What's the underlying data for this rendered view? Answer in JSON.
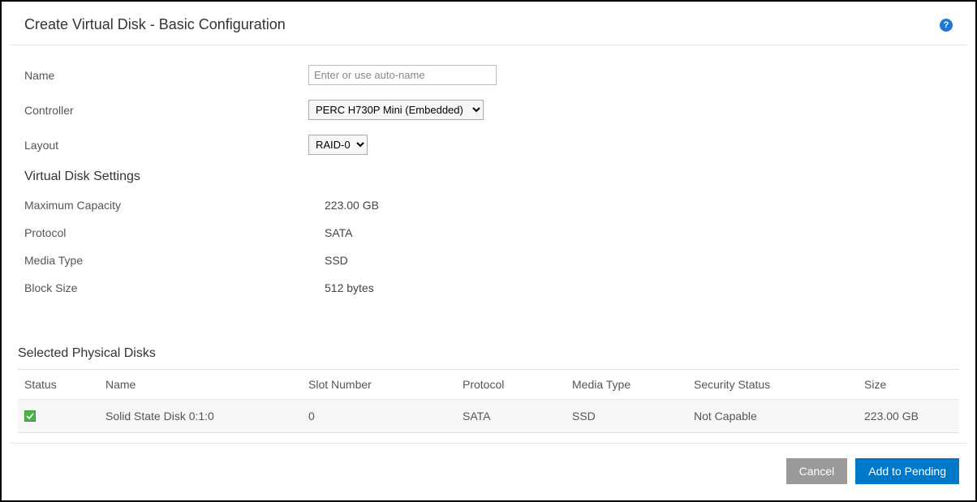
{
  "header": {
    "title": "Create Virtual Disk - Basic Configuration"
  },
  "form": {
    "name_label": "Name",
    "name_placeholder": "Enter or use auto-name",
    "controller_label": "Controller",
    "controller_value": "PERC H730P Mini (Embedded)",
    "layout_label": "Layout",
    "layout_value": "RAID-0"
  },
  "vds": {
    "title": "Virtual Disk Settings",
    "rows": [
      {
        "label": "Maximum Capacity",
        "value": "223.00 GB"
      },
      {
        "label": "Protocol",
        "value": "SATA"
      },
      {
        "label": "Media Type",
        "value": "SSD"
      },
      {
        "label": "Block Size",
        "value": "512 bytes"
      }
    ]
  },
  "phys": {
    "title": "Selected Physical Disks",
    "columns": {
      "status": "Status",
      "name": "Name",
      "slot": "Slot Number",
      "protocol": "Protocol",
      "media": "Media Type",
      "security": "Security Status",
      "size": "Size"
    },
    "rows": [
      {
        "status": "ok",
        "name": "Solid State Disk 0:1:0",
        "slot": "0",
        "protocol": "SATA",
        "media": "SSD",
        "security": "Not Capable",
        "size": "223.00 GB"
      }
    ]
  },
  "footer": {
    "cancel": "Cancel",
    "add": "Add to Pending"
  }
}
